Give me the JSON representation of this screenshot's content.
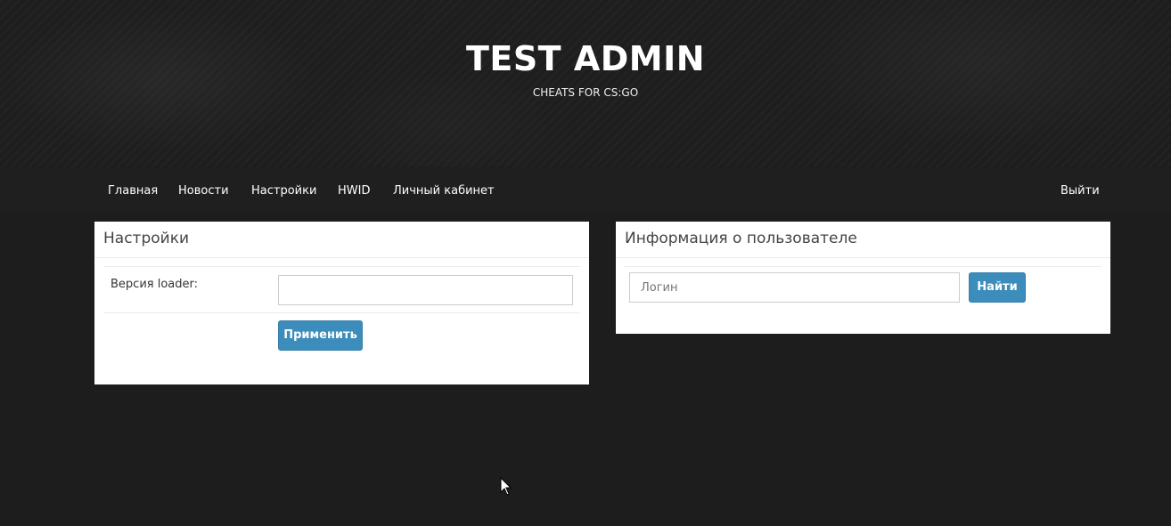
{
  "header": {
    "title": "TEST ADMIN",
    "subtitle": "CHEATS FOR CS:GO"
  },
  "nav": {
    "items": [
      {
        "label": "Главная"
      },
      {
        "label": "Новости"
      },
      {
        "label": "Настройки"
      },
      {
        "label": "HWID"
      },
      {
        "label": "Личный кабинет"
      }
    ],
    "logout": "Выйти"
  },
  "settings_panel": {
    "title": "Настройки",
    "version_label": "Версия loader:",
    "version_value": "",
    "apply_button": "Применить"
  },
  "user_panel": {
    "title": "Информация о пользователе",
    "login_placeholder": "Логин",
    "find_button": "Найти"
  },
  "colors": {
    "background": "#1d1d1d",
    "primary_button": "#3c8dbc"
  }
}
